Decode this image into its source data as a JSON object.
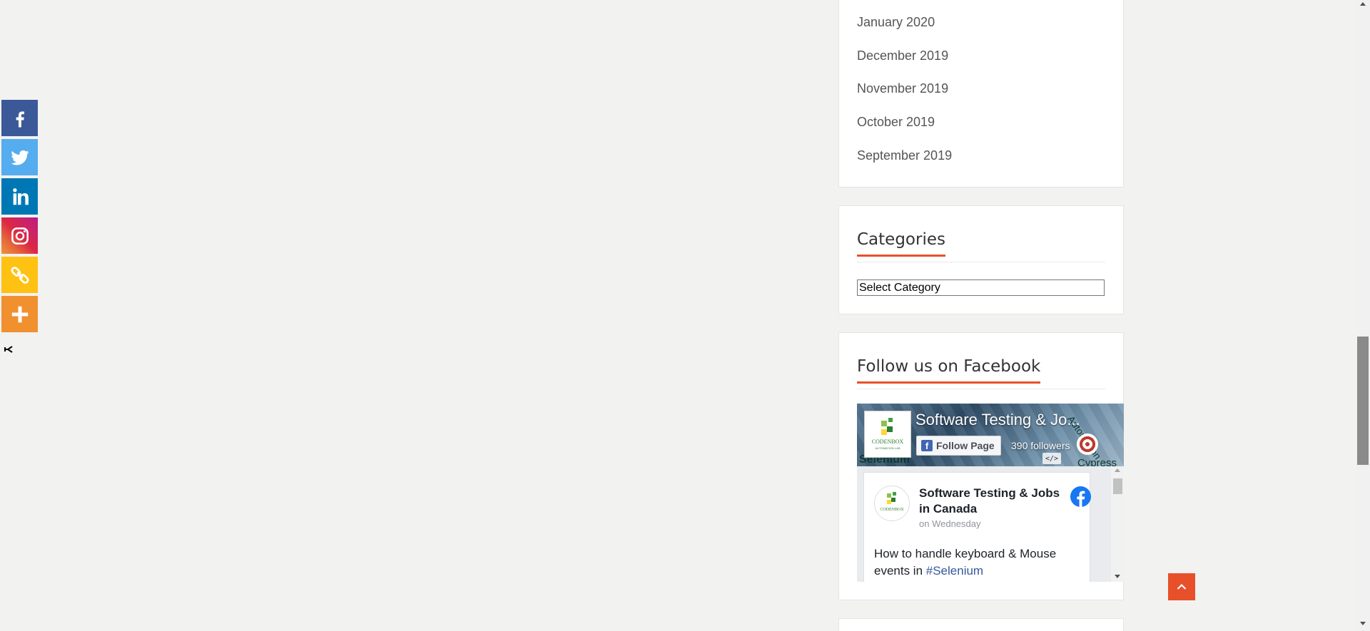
{
  "share_bar": {
    "buttons": [
      {
        "network": "Facebook",
        "icon": "facebook-icon",
        "color": "#3b5998"
      },
      {
        "network": "Twitter",
        "icon": "twitter-icon",
        "color": "#55acee"
      },
      {
        "network": "LinkedIn",
        "icon": "linkedin-icon",
        "color": "#0077b5"
      },
      {
        "network": "Instagram",
        "icon": "instagram-icon",
        "color": "#dc2743"
      },
      {
        "network": "Copy Link",
        "icon": "link-icon",
        "color": "#ffc112"
      },
      {
        "network": "More",
        "icon": "plus-icon",
        "color": "#f0902f"
      }
    ],
    "hide_icon": "hide-arrow-icon"
  },
  "archives": {
    "items": [
      "January 2020",
      "December 2019",
      "November 2019",
      "October 2019",
      "September 2019"
    ]
  },
  "categories": {
    "title": "Categories",
    "select_value": "Select Category"
  },
  "facebook_widget": {
    "title": "Follow us on Facebook",
    "page_name": "Software Testing & Jo...",
    "follow_label": "Follow Page",
    "followers": "390 followers",
    "cover_texts": {
      "selenium": "Selenium",
      "cypress": "Cypress",
      "automation": "Automation"
    },
    "post": {
      "author": "Software Testing & Jobs in Canada",
      "time": "on Wednesday",
      "text": "How to handle keyboard & Mouse events in ",
      "hashtag": "#Selenium"
    }
  },
  "colors": {
    "accent": "#e8502a",
    "facebook_blue": "#1877f2",
    "background": "#f2f2f1"
  }
}
